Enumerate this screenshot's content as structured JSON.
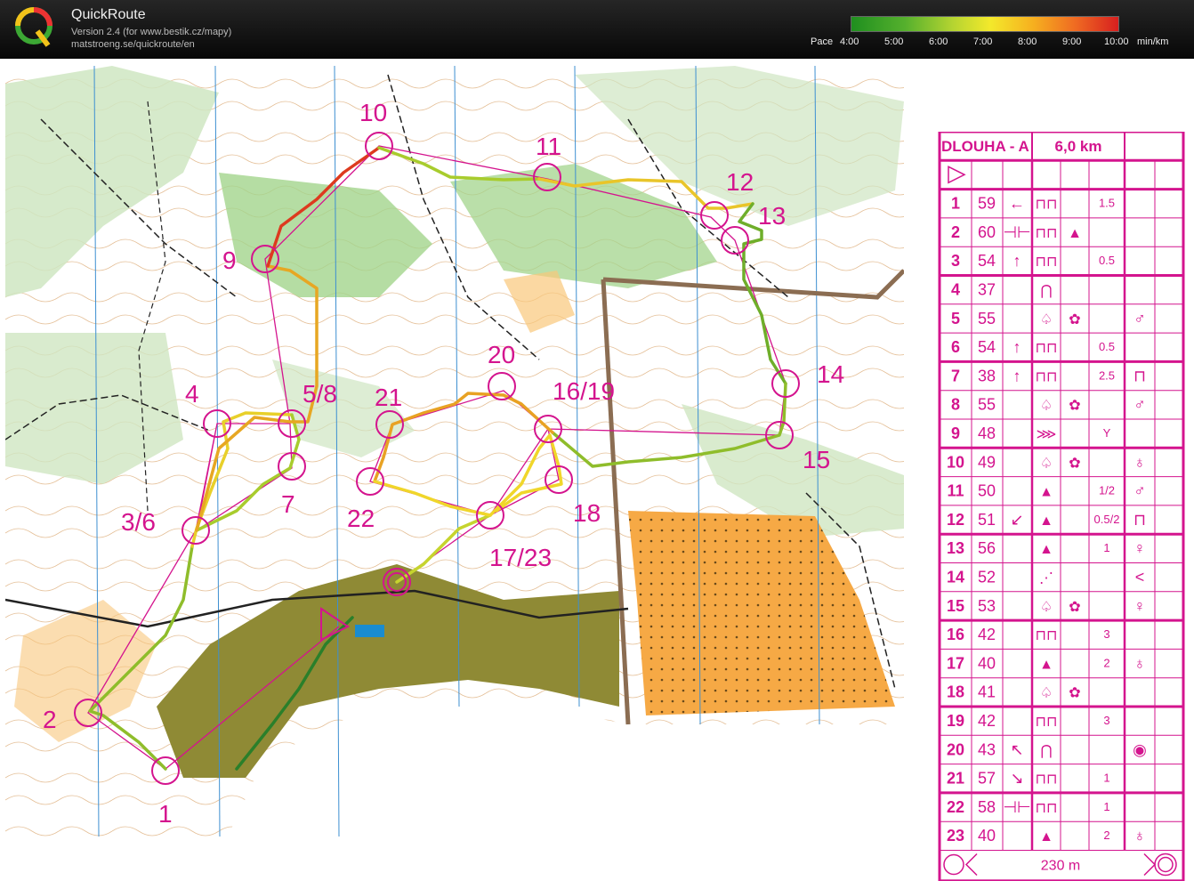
{
  "app": {
    "title": "QuickRoute",
    "version_line": "Version 2.4  (for www.bestik.cz/mapy)",
    "url_line": "matstroeng.se/quickroute/en",
    "logo": "Q"
  },
  "pace": {
    "label": "Pace",
    "ticks": [
      "4:00",
      "5:00",
      "6:00",
      "7:00",
      "8:00",
      "9:00",
      "10:00"
    ],
    "unit": "min/km",
    "colors": [
      "#1f8f1f",
      "#b5d431",
      "#f3e92b",
      "#ef6a22",
      "#d71f1f"
    ]
  },
  "colors": {
    "course": "#d4148e",
    "header_bg": "#111111",
    "forest_light": "#cfe6c2",
    "forest_green": "#a3d48c",
    "open_yellow": "#f6a945",
    "settlement": "#8f8a35"
  },
  "map": {
    "controls": [
      {
        "label": "1"
      },
      {
        "label": "2"
      },
      {
        "label": "3/6"
      },
      {
        "label": "4"
      },
      {
        "label": "5/8"
      },
      {
        "label": "7"
      },
      {
        "label": "9"
      },
      {
        "label": "10"
      },
      {
        "label": "11"
      },
      {
        "label": "12"
      },
      {
        "label": "13"
      },
      {
        "label": "14"
      },
      {
        "label": "15"
      },
      {
        "label": "16/19"
      },
      {
        "label": "17/23"
      },
      {
        "label": "18"
      },
      {
        "label": "20"
      },
      {
        "label": "21"
      },
      {
        "label": "22"
      }
    ]
  },
  "control_description": {
    "course": "DLOUHA - A",
    "length": "6,0 km",
    "finish_distance": "230 m",
    "rows": [
      {
        "n": "1",
        "code": "59",
        "c": "←",
        "d": "⊓⊓",
        "e": "",
        "f": "1.5",
        "g": ""
      },
      {
        "n": "2",
        "code": "60",
        "c": "⊣⊢",
        "d": "⊓⊓",
        "e": "▲",
        "f": "",
        "g": ""
      },
      {
        "n": "3",
        "code": "54",
        "c": "↑",
        "d": "⊓⊓",
        "e": "",
        "f": "0.5",
        "g": ""
      },
      {
        "n": "4",
        "code": "37",
        "c": "",
        "d": "⋂",
        "e": "",
        "f": "",
        "g": ""
      },
      {
        "n": "5",
        "code": "55",
        "c": "",
        "d": "♤",
        "e": "✿",
        "f": "",
        "g": "♂"
      },
      {
        "n": "6",
        "code": "54",
        "c": "↑",
        "d": "⊓⊓",
        "e": "",
        "f": "0.5",
        "g": ""
      },
      {
        "n": "7",
        "code": "38",
        "c": "↑",
        "d": "⊓⊓",
        "e": "",
        "f": "2.5",
        "g": "⊓"
      },
      {
        "n": "8",
        "code": "55",
        "c": "",
        "d": "♤",
        "e": "✿",
        "f": "",
        "g": "♂"
      },
      {
        "n": "9",
        "code": "48",
        "c": "",
        "d": "⋙",
        "e": "",
        "f": "Y",
        "g": ""
      },
      {
        "n": "10",
        "code": "49",
        "c": "",
        "d": "♤",
        "e": "✿",
        "f": "",
        "g": "♁"
      },
      {
        "n": "11",
        "code": "50",
        "c": "",
        "d": "▲",
        "e": "",
        "f": "1/2",
        "g": "♂"
      },
      {
        "n": "12",
        "code": "51",
        "c": "↙",
        "d": "▲",
        "e": "",
        "f": "0.5/2",
        "g": "⊓"
      },
      {
        "n": "13",
        "code": "56",
        "c": "",
        "d": "▲",
        "e": "",
        "f": "1",
        "g": "♀"
      },
      {
        "n": "14",
        "code": "52",
        "c": "",
        "d": "⋰",
        "e": "",
        "f": "",
        "g": "<"
      },
      {
        "n": "15",
        "code": "53",
        "c": "",
        "d": "♤",
        "e": "✿",
        "f": "",
        "g": "♀"
      },
      {
        "n": "16",
        "code": "42",
        "c": "",
        "d": "⊓⊓",
        "e": "",
        "f": "3",
        "g": ""
      },
      {
        "n": "17",
        "code": "40",
        "c": "",
        "d": "▲",
        "e": "",
        "f": "2",
        "g": "♁"
      },
      {
        "n": "18",
        "code": "41",
        "c": "",
        "d": "♤",
        "e": "✿",
        "f": "",
        "g": ""
      },
      {
        "n": "19",
        "code": "42",
        "c": "",
        "d": "⊓⊓",
        "e": "",
        "f": "3",
        "g": ""
      },
      {
        "n": "20",
        "code": "43",
        "c": "↖",
        "d": "⋂",
        "e": "",
        "f": "",
        "g": "◉"
      },
      {
        "n": "21",
        "code": "57",
        "c": "↘",
        "d": "⊓⊓",
        "e": "",
        "f": "1",
        "g": ""
      },
      {
        "n": "22",
        "code": "58",
        "c": "⊣⊢",
        "d": "⊓⊓",
        "e": "",
        "f": "1",
        "g": ""
      },
      {
        "n": "23",
        "code": "40",
        "c": "",
        "d": "▲",
        "e": "",
        "f": "2",
        "g": "♁"
      }
    ]
  }
}
